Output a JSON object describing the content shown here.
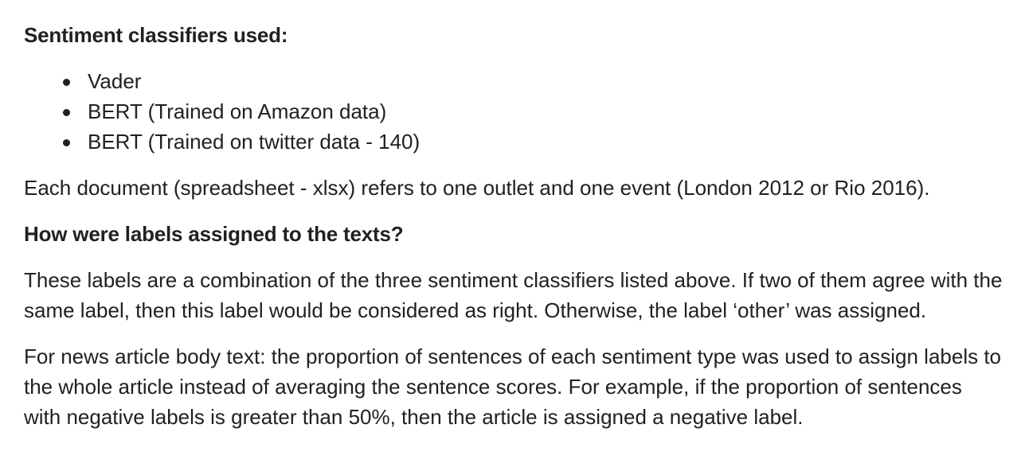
{
  "document": {
    "top_fragment": "",
    "classifiers_heading": "Sentiment classifiers used:",
    "classifiers": [
      "Vader",
      "BERT (Trained on Amazon data)",
      "BERT (Trained on twitter data - 140)"
    ],
    "document_note": "Each document (spreadsheet - xlsx) refers to one outlet and one event (London 2012 or Rio 2016).",
    "labels_heading": "How were labels assigned to the texts?",
    "labels_paragraph": "These labels are a combination of the three sentiment classifiers listed above. If two of them agree with the same label, then this label would be considered as right. Otherwise, the label ‘other’ was assigned.",
    "body_text_paragraph": "For news article body text: the proportion of sentences of each sentiment type was used to assign labels to the whole article instead of averaging the sentence scores. For example, if the proportion of sentences with negative labels is greater than 50%, then the article is assigned a negative label."
  }
}
